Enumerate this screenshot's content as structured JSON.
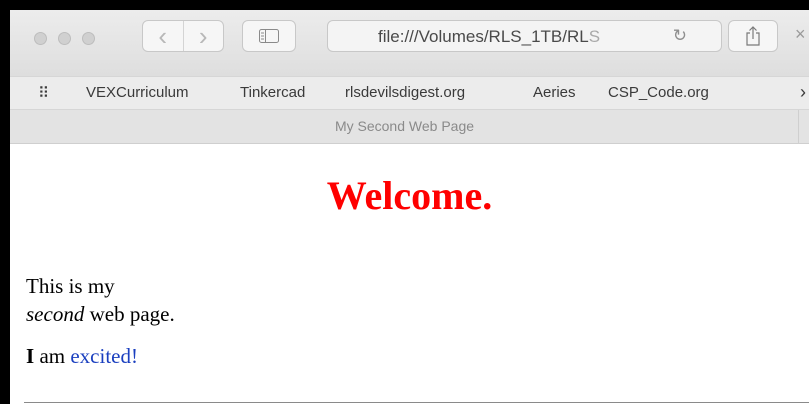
{
  "browser": {
    "address_url": "file:///Volumes/RLS_1TB/RL",
    "address_url_fade": "S",
    "reload_glyph": "↻",
    "back_glyph": "‹",
    "forward_glyph": "›",
    "share_glyph": "⇪",
    "close_glyph": "×"
  },
  "bookmarks": {
    "apps_glyph": "⠿",
    "items": [
      "VEXCurriculum",
      "Tinkercad",
      "rlsdevilsdigest.org",
      "Aeries",
      "CSP_Code.org"
    ],
    "more_glyph": "›"
  },
  "tab": {
    "title": "My Second Web Page"
  },
  "page": {
    "heading": "Welcome.",
    "para1_line1": "This is my",
    "para1_em": "second",
    "para1_rest": " web page.",
    "para2_bold": "I",
    "para2_text": " am ",
    "para2_link": "excited!"
  },
  "colors": {
    "heading": "#ff0000",
    "link": "#1a3fbf"
  }
}
